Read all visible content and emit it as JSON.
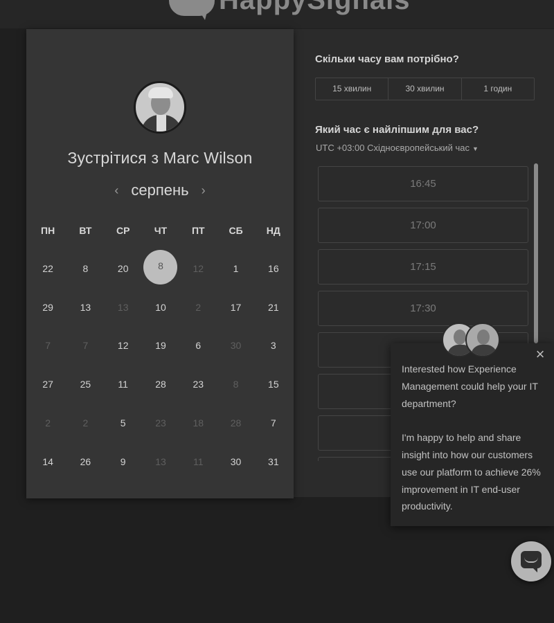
{
  "header": {
    "logo_text": "HappySignals"
  },
  "calendar": {
    "title": "Зустрітися з Marc Wilson",
    "month": "серпень",
    "prev_arrow": "‹",
    "next_arrow": "›",
    "weekdays": [
      "ПН",
      "ВТ",
      "СР",
      "ЧТ",
      "ПТ",
      "СБ",
      "НД"
    ],
    "weeks": [
      [
        {
          "d": "22"
        },
        {
          "d": "8"
        },
        {
          "d": "20"
        },
        {
          "d": "8",
          "selected": true
        },
        {
          "d": "12",
          "dim": true
        },
        {
          "d": "1"
        },
        {
          "d": "16"
        }
      ],
      [
        {
          "d": "29"
        },
        {
          "d": "13"
        },
        {
          "d": "13",
          "dim": true
        },
        {
          "d": "10"
        },
        {
          "d": "2",
          "dim": true
        },
        {
          "d": "17"
        },
        {
          "d": "21"
        }
      ],
      [
        {
          "d": "7",
          "dim": true
        },
        {
          "d": "7",
          "dim": true
        },
        {
          "d": "12"
        },
        {
          "d": "19"
        },
        {
          "d": "6"
        },
        {
          "d": "30",
          "dim": true
        },
        {
          "d": "3"
        }
      ],
      [
        {
          "d": "27"
        },
        {
          "d": "25"
        },
        {
          "d": "11"
        },
        {
          "d": "28"
        },
        {
          "d": "23"
        },
        {
          "d": "8",
          "dim": true
        },
        {
          "d": "15"
        }
      ],
      [
        {
          "d": "2",
          "dim": true
        },
        {
          "d": "2",
          "dim": true
        },
        {
          "d": "5"
        },
        {
          "d": "23",
          "dim": true
        },
        {
          "d": "18",
          "dim": true
        },
        {
          "d": "28",
          "dim": true
        },
        {
          "d": "7"
        }
      ],
      [
        {
          "d": "14"
        },
        {
          "d": "26"
        },
        {
          "d": "9"
        },
        {
          "d": "13",
          "dim": true
        },
        {
          "d": "11",
          "dim": true
        },
        {
          "d": "30"
        },
        {
          "d": "31"
        }
      ]
    ]
  },
  "duration": {
    "question": "Скільки часу вам потрібно?",
    "options": [
      "15 хвилин",
      "30 хвилин",
      "1 годин"
    ]
  },
  "time": {
    "question": "Який час є найліпшим для вас?",
    "timezone": "UTC +03:00 Східноєвропейський час",
    "slots": [
      "16:45",
      "17:00",
      "17:15",
      "17:30",
      "",
      "",
      "",
      ""
    ]
  },
  "chat": {
    "close": "×",
    "paragraphs": [
      "Interested how Experience Management could help your IT department?",
      "I'm happy to help and share insight into how our customers use our platform to achieve 26% improvement in IT end-user productivity."
    ]
  }
}
